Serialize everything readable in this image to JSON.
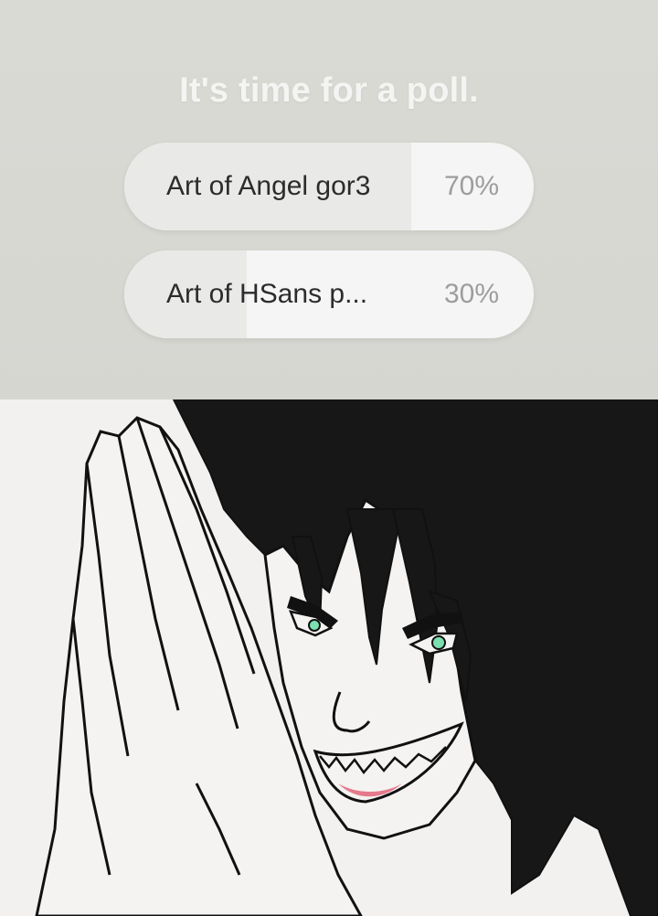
{
  "poll": {
    "title": "It's time for a poll.",
    "options": [
      {
        "label": "Art of Angel gor3",
        "percent_text": "70%",
        "percent": 70
      },
      {
        "label": "Art of HSans p...",
        "percent_text": "30%",
        "percent": 30
      }
    ]
  },
  "colors": {
    "poll_background": "#d8d8d3",
    "option_background": "#f5f5f5",
    "option_fill": "#e9e9e7",
    "title_text": "#f4f4f2",
    "label_text": "#2c2c2c",
    "percent_text": "#9d9d9d",
    "hair": "#171717",
    "eye": "#7be0b0",
    "mouth": "#e47a8c"
  },
  "image": {
    "subject": "drawing-praying-hands-grinning-character"
  }
}
